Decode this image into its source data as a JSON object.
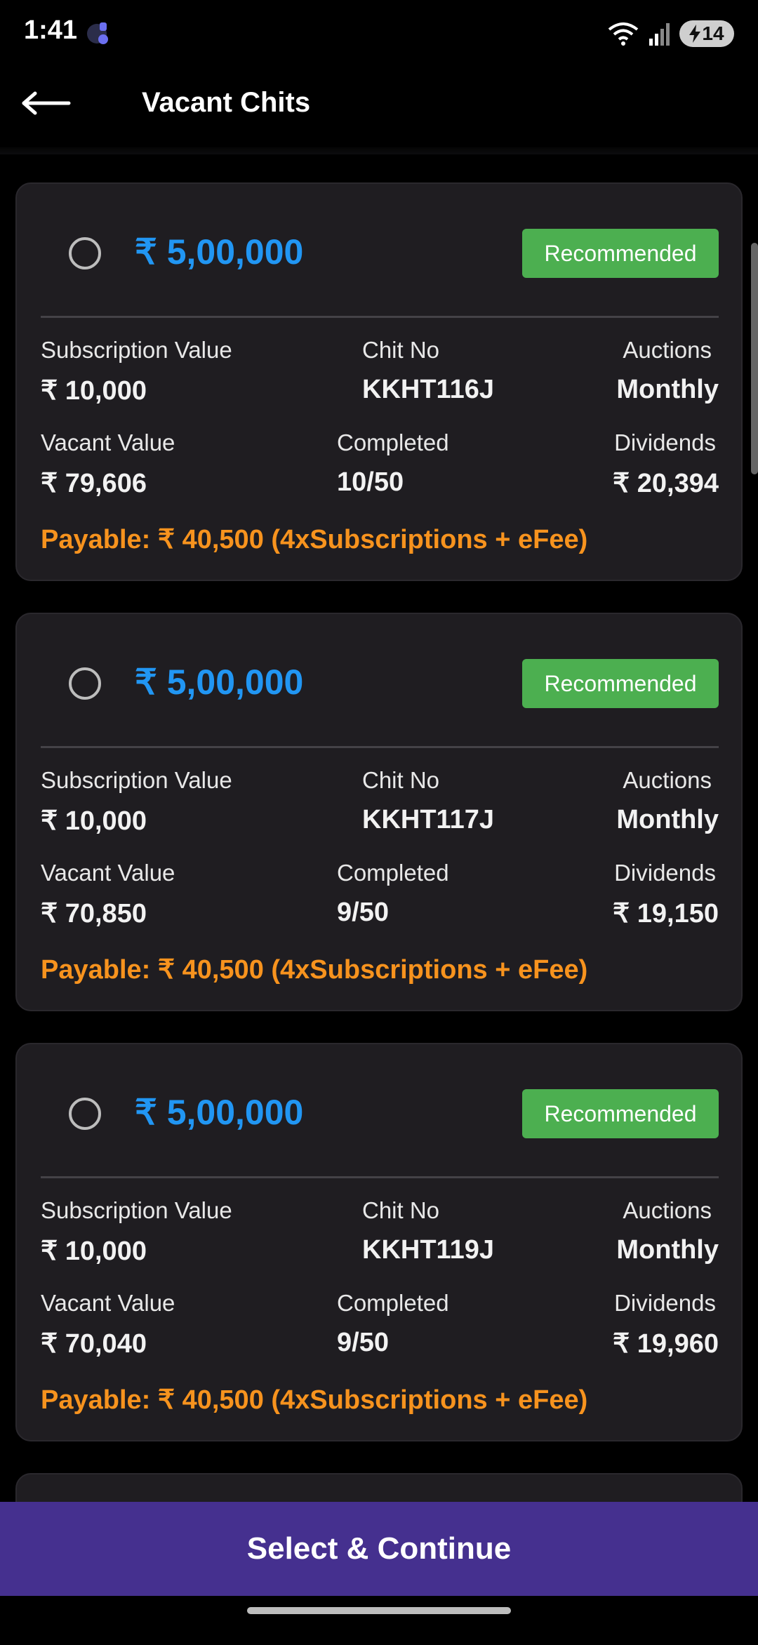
{
  "status": {
    "time": "1:41",
    "battery": "14"
  },
  "header": {
    "title": "Vacant Chits"
  },
  "labels": {
    "subscription": "Subscription Value",
    "chit_no": "Chit No",
    "auctions": "Auctions",
    "vacant": "Vacant Value",
    "completed": "Completed",
    "dividends": "Dividends",
    "badge": "Recommended"
  },
  "chits": [
    {
      "amount": "₹ 5,00,000",
      "subscription": "₹ 10,000",
      "chit_no": "KKHT116J",
      "auctions": "Monthly",
      "vacant": "₹ 79,606",
      "completed": "10/50",
      "dividends": "₹ 20,394",
      "payable": "Payable: ₹ 40,500 (4xSubscriptions + eFee)"
    },
    {
      "amount": "₹ 5,00,000",
      "subscription": "₹ 10,000",
      "chit_no": "KKHT117J",
      "auctions": "Monthly",
      "vacant": "₹ 70,850",
      "completed": "9/50",
      "dividends": "₹ 19,150",
      "payable": "Payable: ₹ 40,500 (4xSubscriptions + eFee)"
    },
    {
      "amount": "₹ 5,00,000",
      "subscription": "₹ 10,000",
      "chit_no": "KKHT119J",
      "auctions": "Monthly",
      "vacant": "₹ 70,040",
      "completed": "9/50",
      "dividends": "₹ 19,960",
      "payable": "Payable: ₹ 40,500 (4xSubscriptions + eFee)"
    }
  ],
  "footer": {
    "cta_label": "Select & Continue"
  },
  "colors": {
    "amount": "#2196f3",
    "badge": "#4caf50",
    "payable": "#f7931e",
    "cta": "#45308f"
  }
}
